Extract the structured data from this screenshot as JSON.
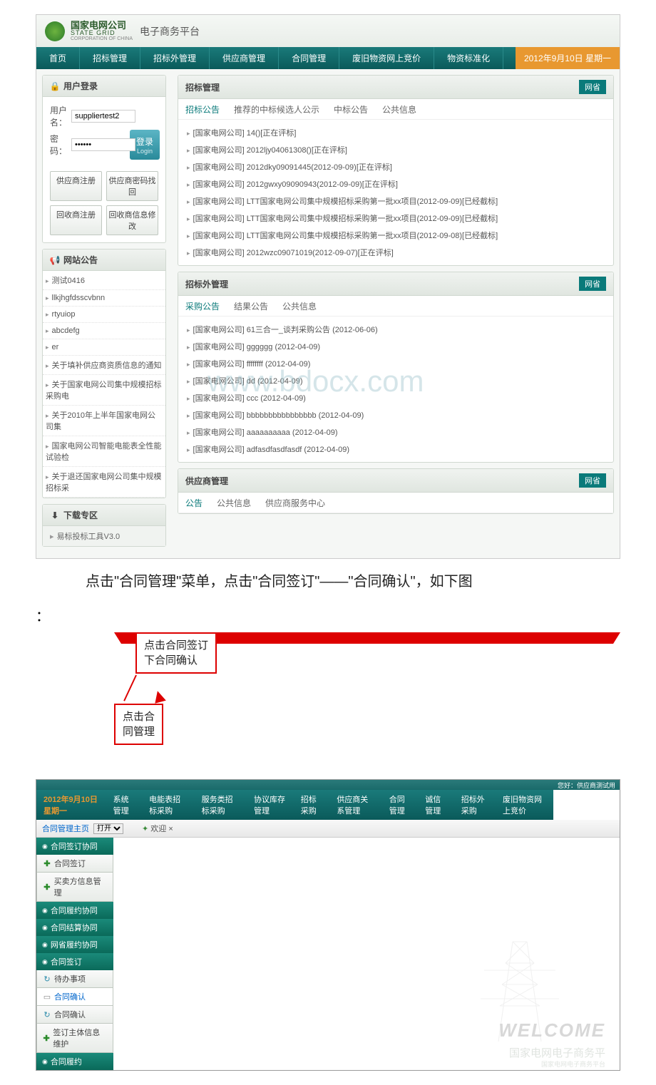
{
  "logo": {
    "cn": "国家电网公司",
    "en": "STATE GRID",
    "sub": "CORPORATION OF CHINA"
  },
  "platform_title": "电子商务平台",
  "top_menu": [
    "首页",
    "招标管理",
    "招标外管理",
    "供应商管理",
    "合同管理",
    "废旧物资网上竞价",
    "物资标准化"
  ],
  "top_date": "2012年9月10日 星期一",
  "login": {
    "title": "用户登录",
    "user_label": "用户名：",
    "user_value": "suppliertest2",
    "pass_label": "密 码：",
    "pass_value": "••••••",
    "btn": "登录",
    "btn_en": "Login",
    "buttons1": [
      "供应商注册",
      "供应商密码找回"
    ],
    "buttons2": [
      "回收商注册",
      "回收商信息修改"
    ]
  },
  "notice": {
    "title": "网站公告",
    "items": [
      "测试0416",
      "llkjhgfdsscvbnn",
      "rtyuiop",
      "abcdefg",
      "er",
      "关于填补供应商资质信息的通知",
      "关于国家电网公司集中规模招标采购电",
      "关于2010年上半年国家电网公司集",
      "国家电网公司智能电能表全性能试验检",
      "关于退还国家电网公司集中规模招标采"
    ]
  },
  "download": {
    "title": "下载专区",
    "item": "易标投标工具V3.0"
  },
  "section1": {
    "title": "招标管理",
    "tag": "网省",
    "tabs": [
      "招标公告",
      "推荐的中标候选人公示",
      "中标公告",
      "公共信息"
    ],
    "items": [
      "[国家电网公司]  14()[正在评标]",
      "[国家电网公司]  2012ljy04061308()[正在评标]",
      "[国家电网公司]  2012dky09091445(2012-09-09)[正在评标]",
      "[国家电网公司]  2012gwxy09090943(2012-09-09)[正在评标]",
      "[国家电网公司]  LTT国家电网公司集中规模招标采购第一批xx项目(2012-09-09)[已经截标]",
      "[国家电网公司]  LTT国家电网公司集中规模招标采购第一批xx项目(2012-09-09)[已经截标]",
      "[国家电网公司]  LTT国家电网公司集中规模招标采购第一批xx项目(2012-09-08)[已经截标]",
      "[国家电网公司]  2012wzc09071019(2012-09-07)[正在评标]"
    ]
  },
  "section2": {
    "title": "招标外管理",
    "tag": "网省",
    "tabs": [
      "采购公告",
      "结果公告",
      "公共信息"
    ],
    "items": [
      "[国家电网公司]  61三合一_谈判采购公告  (2012-06-06)",
      "[国家电网公司]  gggggg (2012-04-09)",
      "[国家电网公司]  ffffffff (2012-04-09)",
      "[国家电网公司]  dd (2012-04-09)",
      "[国家电网公司]  ccc (2012-04-09)",
      "[国家电网公司]  bbbbbbbbbbbbbbbb (2012-04-09)",
      "[国家电网公司]  aaaaaaaaaa (2012-04-09)",
      "[国家电网公司]  adfasdfasdfasdf (2012-04-09)"
    ]
  },
  "section3": {
    "title": "供应商管理",
    "tag": "网省",
    "tabs": [
      "公告",
      "公共信息",
      "供应商服务中心"
    ]
  },
  "watermark": "www.bdocx.com",
  "instruction": "点击\"合同管理\"菜单，点击\"合同签订\"——\"合同确认\"，如下图",
  "callout1_l1": "点击合同签订",
  "callout1_l2": "下合同确认",
  "callout2_l1": "点击合",
  "callout2_l2": "同管理",
  "bottom": {
    "top_right": "您好：供应商测试用",
    "date": "2012年9月10日 星期一",
    "menu": [
      "系统管理",
      "电能表招标采购",
      "服务类招标采购",
      "协议库存管理",
      "招标采购",
      "供应商关系管理",
      "合同管理",
      "诚信管理",
      "招标外采购",
      "废旧物资网上竞价"
    ],
    "crumb": "合同管理主页",
    "crumb_sel": "打开",
    "welcome_tab": "欢迎",
    "tree": [
      {
        "type": "cat",
        "label": "合同签订协同"
      },
      {
        "type": "leaf",
        "icon": "plus",
        "label": "合同签订"
      },
      {
        "type": "leaf",
        "icon": "plus",
        "label": "买卖方信息管理"
      },
      {
        "type": "cat",
        "label": "合同履约协同"
      },
      {
        "type": "cat",
        "label": "合同结算协同"
      },
      {
        "type": "cat",
        "label": "网省履约协同"
      },
      {
        "type": "cat",
        "label": "合同签订"
      },
      {
        "type": "leaf",
        "icon": "refresh",
        "label": "待办事项"
      },
      {
        "type": "leaf",
        "icon": "doc",
        "label": "合同确认",
        "hl": true
      },
      {
        "type": "leaf",
        "icon": "refresh",
        "label": "合同确认"
      },
      {
        "type": "leaf",
        "icon": "plus",
        "label": "签订主体信息维护"
      },
      {
        "type": "cat",
        "label": "合同履约"
      }
    ],
    "wm_welcome": "WELCOME",
    "wm_brand": "国家电网电子商务平",
    "wm_sub": "国家电网电子商务平台"
  }
}
